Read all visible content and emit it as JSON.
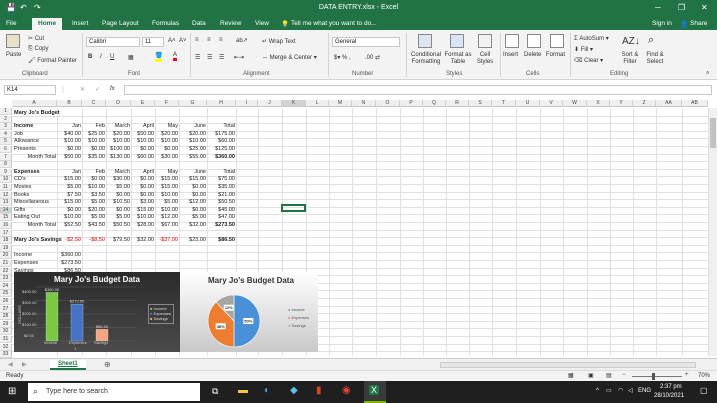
{
  "window": {
    "title": "DATA ENTRY.xlsx - Excel"
  },
  "account": {
    "signin": "Sign in",
    "share": "Share"
  },
  "ribbon_tabs": [
    "File",
    "Home",
    "Insert",
    "Page Layout",
    "Formulas",
    "Data",
    "Review",
    "View"
  ],
  "tell_me": "Tell me what you want to do...",
  "ribbon": {
    "paste": "Paste",
    "cut": "Cut",
    "copy": "Copy",
    "format_painter": "Format Painter",
    "clipboard": "Clipboard",
    "font_name": "Calibri",
    "font_size": "11",
    "font": "Font",
    "wrap_text": "Wrap Text",
    "merge_center": "Merge & Center",
    "alignment": "Alignment",
    "number_format": "General",
    "number": "Number",
    "conditional_formatting": "Conditional Formatting",
    "format_as_table": "Format as Table",
    "cell_styles": "Cell Styles",
    "styles": "Styles",
    "insert": "Insert",
    "delete": "Delete",
    "format": "Format",
    "cells": "Cells",
    "autosum": "AutoSum",
    "fill": "Fill",
    "clear": "Clear",
    "sort_filter": "Sort & Filter",
    "find_select": "Find & Select",
    "editing": "Editing",
    "bold": "B",
    "italic": "I",
    "underline": "U"
  },
  "formula_bar": {
    "name_box": "K14",
    "fx": "fx",
    "value": ""
  },
  "columns": [
    "A",
    "B",
    "C",
    "D",
    "E",
    "F",
    "G",
    "H",
    "I",
    "J",
    "K",
    "L",
    "M",
    "N",
    "O",
    "P",
    "Q",
    "R",
    "S",
    "T",
    "U",
    "V",
    "W",
    "X",
    "Y",
    "Z",
    "AA",
    "AB"
  ],
  "rows": [
    "1",
    "2",
    "3",
    "4",
    "5",
    "6",
    "7",
    "8",
    "9",
    "10",
    "11",
    "12",
    "13",
    "14",
    "15",
    "16",
    "17",
    "18",
    "19",
    "20",
    "21",
    "22",
    "23",
    "24",
    "25",
    "26",
    "27",
    "28",
    "29",
    "30",
    "31",
    "32",
    "33"
  ],
  "sheet": {
    "title": "Mary Jo's Budget",
    "income_header": [
      "Income",
      "Jan",
      "Feb",
      "March",
      "April",
      "May",
      "June",
      "Total"
    ],
    "income_rows": [
      [
        "Job",
        "$40.00",
        "$25.00",
        "$20.00",
        "$50.00",
        "$20.00",
        "$20.00",
        "$175.00"
      ],
      [
        "Allowance",
        "$10.00",
        "$10.00",
        "$10.00",
        "$10.00",
        "$10.00",
        "$10.00",
        "$60.00"
      ],
      [
        "Presents",
        "$0.00",
        "$0.00",
        "$100.00",
        "$0.00",
        "$0.00",
        "$25.00",
        "$125.00"
      ]
    ],
    "income_total": [
      "Month Total",
      "$50.00",
      "$35.00",
      "$130.00",
      "$60.00",
      "$30.00",
      "$55.00",
      "$360.00"
    ],
    "expenses_header": [
      "Expenses",
      "Jan",
      "Feb",
      "March",
      "April",
      "May",
      "June",
      "Total"
    ],
    "expense_rows": [
      [
        "CD's",
        "$15.00",
        "$0.00",
        "$30.00",
        "$0.00",
        "$15.00",
        "$15.00",
        "$75.00"
      ],
      [
        "Movies",
        "$5.00",
        "$10.00",
        "$5.00",
        "$0.00",
        "$15.00",
        "$0.00",
        "$35.00"
      ],
      [
        "Books",
        "$7.50",
        "$3.50",
        "$0.00",
        "$0.00",
        "$10.00",
        "$0.00",
        "$21.00"
      ],
      [
        "Miscellaneous",
        "$15.00",
        "$5.00",
        "$10.50",
        "$3.00",
        "$5.00",
        "$12.00",
        "$50.50"
      ],
      [
        "Gifts",
        "$0.00",
        "$20.00",
        "$0.00",
        "$15.00",
        "$10.00",
        "$0.00",
        "$45.00"
      ],
      [
        "Eating Out",
        "$10.00",
        "$5.00",
        "$5.00",
        "$10.00",
        "$12.00",
        "$5.00",
        "$47.00"
      ]
    ],
    "expense_total": [
      "Month Total",
      "$52.50",
      "$43.50",
      "$50.50",
      "$28.00",
      "$67.00",
      "$32.00",
      "$273.50"
    ],
    "savings_row": [
      "Mary Jo's Savings",
      "-$2.50",
      "-$8.50",
      "$79.50",
      "$32.00",
      "-$37.00",
      "$23.00",
      "$86.50"
    ],
    "summary": [
      [
        "Income",
        "$360.00"
      ],
      [
        "Expenses",
        "$273.50"
      ],
      [
        "Savings",
        "$86.50"
      ]
    ]
  },
  "chart_data": [
    {
      "type": "bar",
      "title": "Mary Jo's Budget Data",
      "categories": [
        "Income",
        "Expenses",
        "Savings"
      ],
      "values": [
        360.0,
        273.5,
        86.5
      ],
      "data_labels": [
        "$360.00",
        "$273.50",
        "$86.50"
      ],
      "ylabel": "DOLLARS",
      "xlabel": "1",
      "ylim": [
        0,
        400
      ],
      "yticks": [
        "$400.00",
        "$300.00",
        "$200.00",
        "$100.00",
        "$0.00"
      ],
      "legend": [
        "Income",
        "Expenses",
        "Savings"
      ],
      "legend_position": "right",
      "colors": [
        "#7ac943",
        "#4472c4",
        "#f4a582"
      ]
    },
    {
      "type": "pie",
      "title": "Mary Jo's Budget Data",
      "categories": [
        "Income",
        "Expenses",
        "Savings"
      ],
      "values": [
        50,
        38,
        12
      ],
      "data_labels": [
        "50%",
        "38%",
        "12%"
      ],
      "legend_position": "right",
      "colors": [
        "#4a90d9",
        "#ed7d31",
        "#a5a5a5"
      ]
    }
  ],
  "sheet_tabs": [
    "Sheet1"
  ],
  "status": {
    "ready": "Ready",
    "zoom": "70%"
  },
  "taskbar": {
    "search": "Type here to search",
    "time": "2:37 pm",
    "date": "28/10/2021",
    "lang": "ENG"
  }
}
